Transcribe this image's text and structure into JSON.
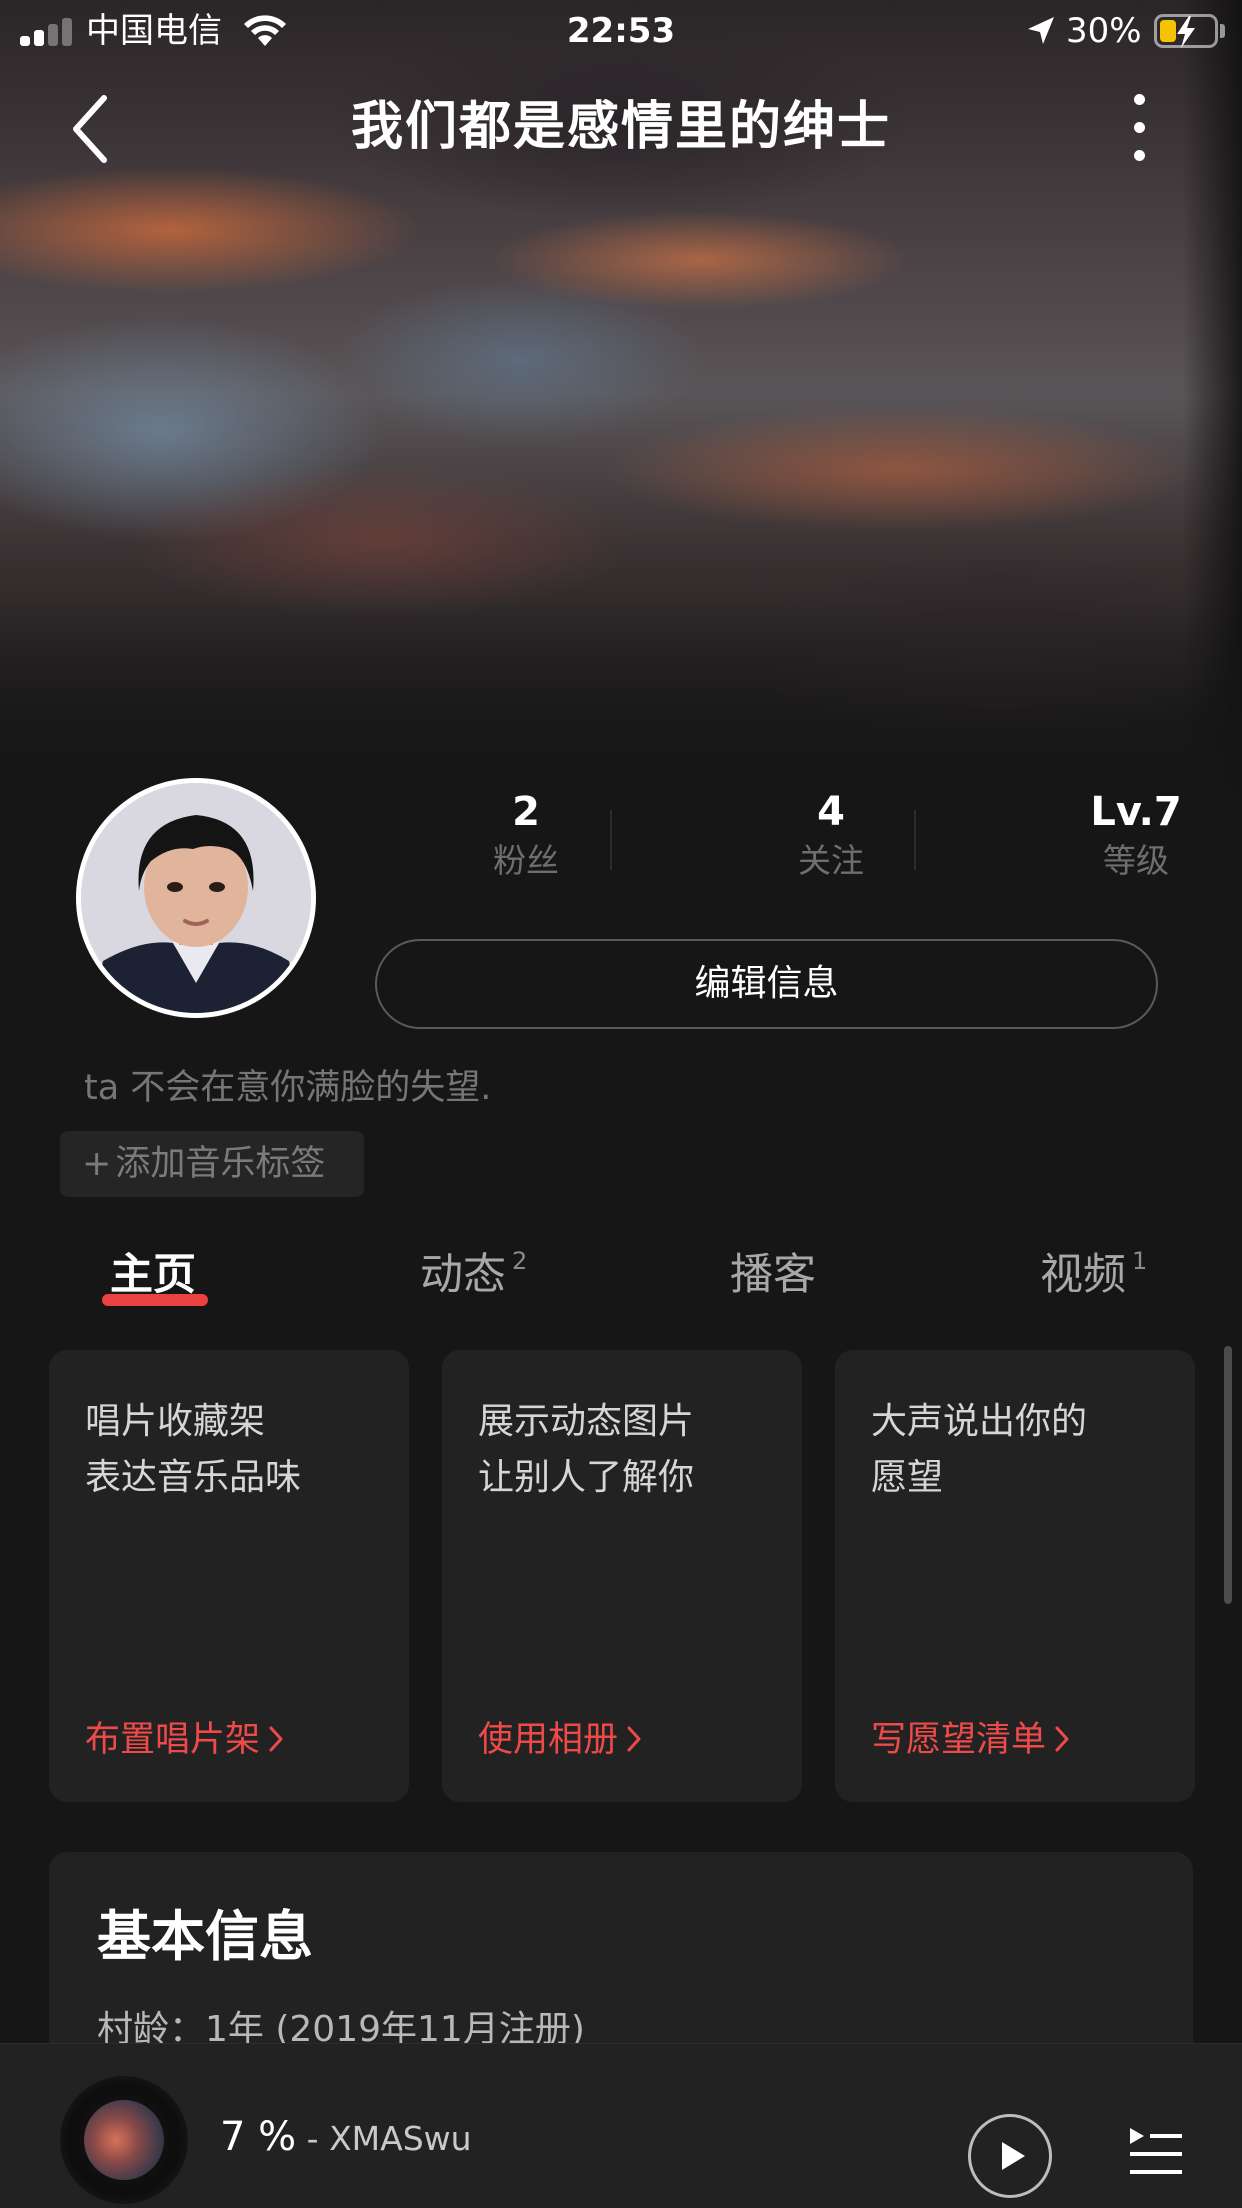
{
  "status_bar": {
    "carrier": "中国电信",
    "time": "22:53",
    "battery_percent": "30%",
    "battery_fill_fraction": 0.3,
    "signal_bars_filled": 2,
    "signal_bars_total": 4
  },
  "nav": {
    "title": "我们都是感情里的绅士"
  },
  "profile": {
    "stats": [
      {
        "value": "2",
        "label": "粉丝"
      },
      {
        "value": "4",
        "label": "关注"
      },
      {
        "value": "Lv.7",
        "label": "等级"
      }
    ],
    "edit_button_label": "编辑信息",
    "signature": "ta 不会在意你满脸的失望.",
    "add_tag_label": "添加音乐标签"
  },
  "tabs": [
    {
      "label": "主页",
      "badge": ""
    },
    {
      "label": "动态",
      "badge": "2"
    },
    {
      "label": "播客",
      "badge": ""
    },
    {
      "label": "视频",
      "badge": "1"
    }
  ],
  "cards": [
    {
      "line1": "唱片收藏架",
      "line2": "表达音乐品味",
      "link": "布置唱片架"
    },
    {
      "line1": "展示动态图片",
      "line2": "让别人了解你",
      "link": "使用相册"
    },
    {
      "line1": "大声说出你的",
      "line2": "愿望",
      "link": "写愿望清单"
    }
  ],
  "basic_info": {
    "title": "基本信息",
    "row": "村龄：1年 (2019年11月注册)"
  },
  "player": {
    "track": "7 %",
    "separator": " - ",
    "artist": "XMASwu"
  },
  "colors": {
    "accent": "#ec4141",
    "link": "#ef4a4a",
    "background": "#161616",
    "card": "#222222",
    "battery_fill": "#f5c400"
  }
}
